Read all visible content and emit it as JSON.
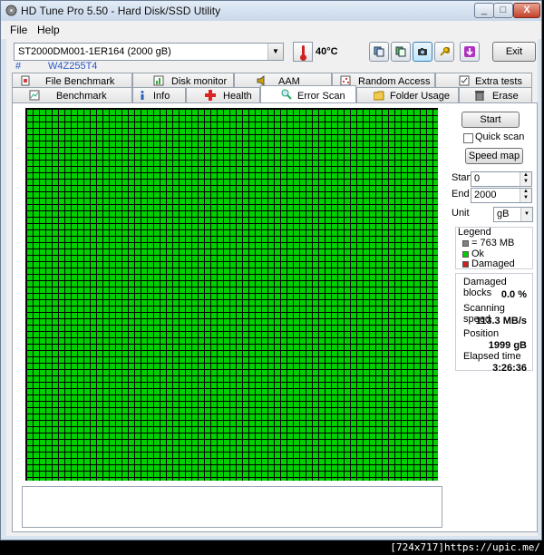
{
  "window": {
    "title": "HD Tune Pro 5.50 - Hard Disk/SSD Utility",
    "min": "_",
    "max": "□",
    "close": "X"
  },
  "menu": {
    "file": "File",
    "help": "Help"
  },
  "drive": {
    "name": "ST2000DM001-1ER164 (2000 gB)",
    "serial_hash": "#",
    "serial": "W4Z255T4",
    "temperature": "40°C"
  },
  "toolbar": {
    "exit": "Exit",
    "icons": [
      "copy-info-icon",
      "copy-all-icon",
      "camera-icon",
      "settings-wrench-icon",
      "download-icon"
    ]
  },
  "tabs_top": [
    "File Benchmark",
    "Disk monitor",
    "AAM",
    "Random Access",
    "Extra tests"
  ],
  "tabs_bottom": [
    "Benchmark",
    "Info",
    "Health",
    "Error Scan",
    "Folder Usage",
    "Erase"
  ],
  "active_tab": "Error Scan",
  "scan": {
    "start_button": "Start",
    "quick_scan_label": "Quick scan",
    "quick_scan_checked": false,
    "speed_map_button": "Speed map",
    "start_label": "Start",
    "start_value": "0",
    "end_label": "End",
    "end_value": "2000",
    "unit_label": "Unit",
    "unit_value": "gB"
  },
  "legend": {
    "title": "Legend",
    "block_size": "= 763 MB",
    "ok": "Ok",
    "damaged": "Damaged",
    "colors": {
      "block": "#808080",
      "ok": "#00d000",
      "damaged": "#d02020"
    }
  },
  "stats": {
    "damaged_blocks_label": "Damaged blocks",
    "damaged_blocks_value": "0.0 %",
    "scanning_speed_label": "Scanning speed",
    "scanning_speed_value": "113.3 MB/s",
    "position_label": "Position",
    "position_value": "1999 gB",
    "elapsed_label": "Elapsed time",
    "elapsed_value": "3:26:36"
  },
  "footer": {
    "watermark": "[724x717]https://upic.me/"
  }
}
